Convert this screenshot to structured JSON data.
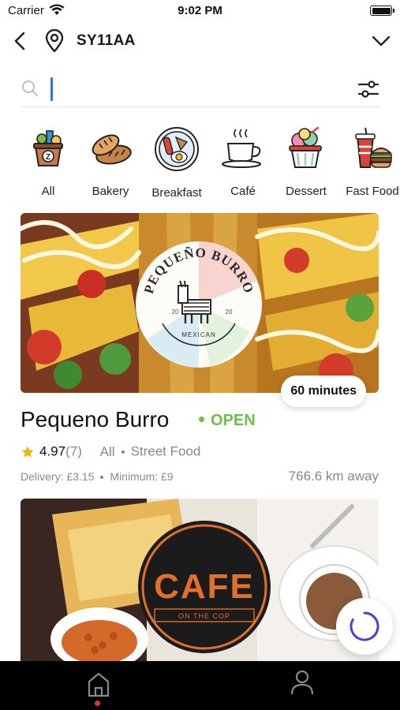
{
  "status_bar": {
    "carrier": "Carrier",
    "time": "9:02 PM"
  },
  "header": {
    "location_code": "SY11AA"
  },
  "search": {
    "value": "",
    "placeholder": ""
  },
  "categories": [
    {
      "label": "All",
      "icon": "grocery-bag-icon"
    },
    {
      "label": "Bakery",
      "icon": "bread-icon"
    },
    {
      "label": "Breakfast",
      "icon": "breakfast-plate-icon"
    },
    {
      "label": "Café",
      "icon": "coffee-cup-icon"
    },
    {
      "label": "Dessert",
      "icon": "ice-cream-icon"
    },
    {
      "label": "Fast Food",
      "icon": "burger-drink-icon"
    }
  ],
  "restaurants": [
    {
      "name": "Pequeno Burro",
      "status": "OPEN",
      "rating": "4.97",
      "rating_count": "(7)",
      "category": "All",
      "cuisine": "Street Food",
      "delivery": "Delivery: £3.15",
      "minimum": "Minimum: £9",
      "distance": "766.6 km away",
      "delivery_time": "60 minutes",
      "logo": {
        "title": "PEQUEÑO BURRO",
        "year_left": "20",
        "year_right": "20",
        "subtitle": "MEXICAN"
      }
    },
    {
      "logo": {
        "title": "CAFE",
        "subtitle": "ON THE COP"
      }
    }
  ],
  "colors": {
    "accent_blue": "#2f6ef5",
    "open_green": "#6cc04a",
    "star": "#f5b400",
    "nav_bg": "#000000",
    "nav_dot": "#e5322d"
  }
}
